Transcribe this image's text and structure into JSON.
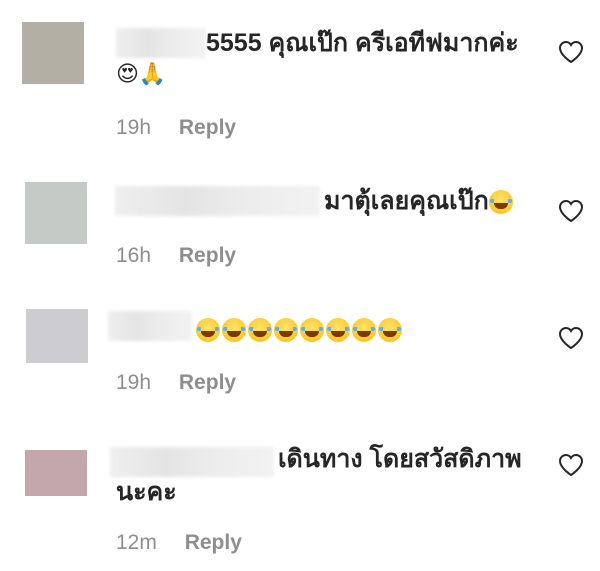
{
  "comments": [
    {
      "avatar_color": "#b3afa5",
      "text": "5555 คุณเป๊ก ครีเอทีฟมากค่ะ",
      "emoji_line": "😍🙏",
      "time": "19h",
      "reply_label": "Reply"
    },
    {
      "avatar_color": "#c6cac7",
      "text": "มาตุ้เลยคุณเป๊ก",
      "time": "16h",
      "reply_label": "Reply"
    },
    {
      "avatar_color": "#cdccd0",
      "text": "",
      "laugh_count": 8,
      "time": "19h",
      "reply_label": "Reply"
    },
    {
      "avatar_color": "#c4a7ac",
      "text": "เดินทาง โดยสวัสดิภาพ",
      "text_line2": "นะคะ",
      "time": "12m",
      "reply_label": "Reply"
    }
  ],
  "icons": {
    "like": "heart-outline-icon",
    "laugh": "tears-of-joy-emoji-icon"
  }
}
